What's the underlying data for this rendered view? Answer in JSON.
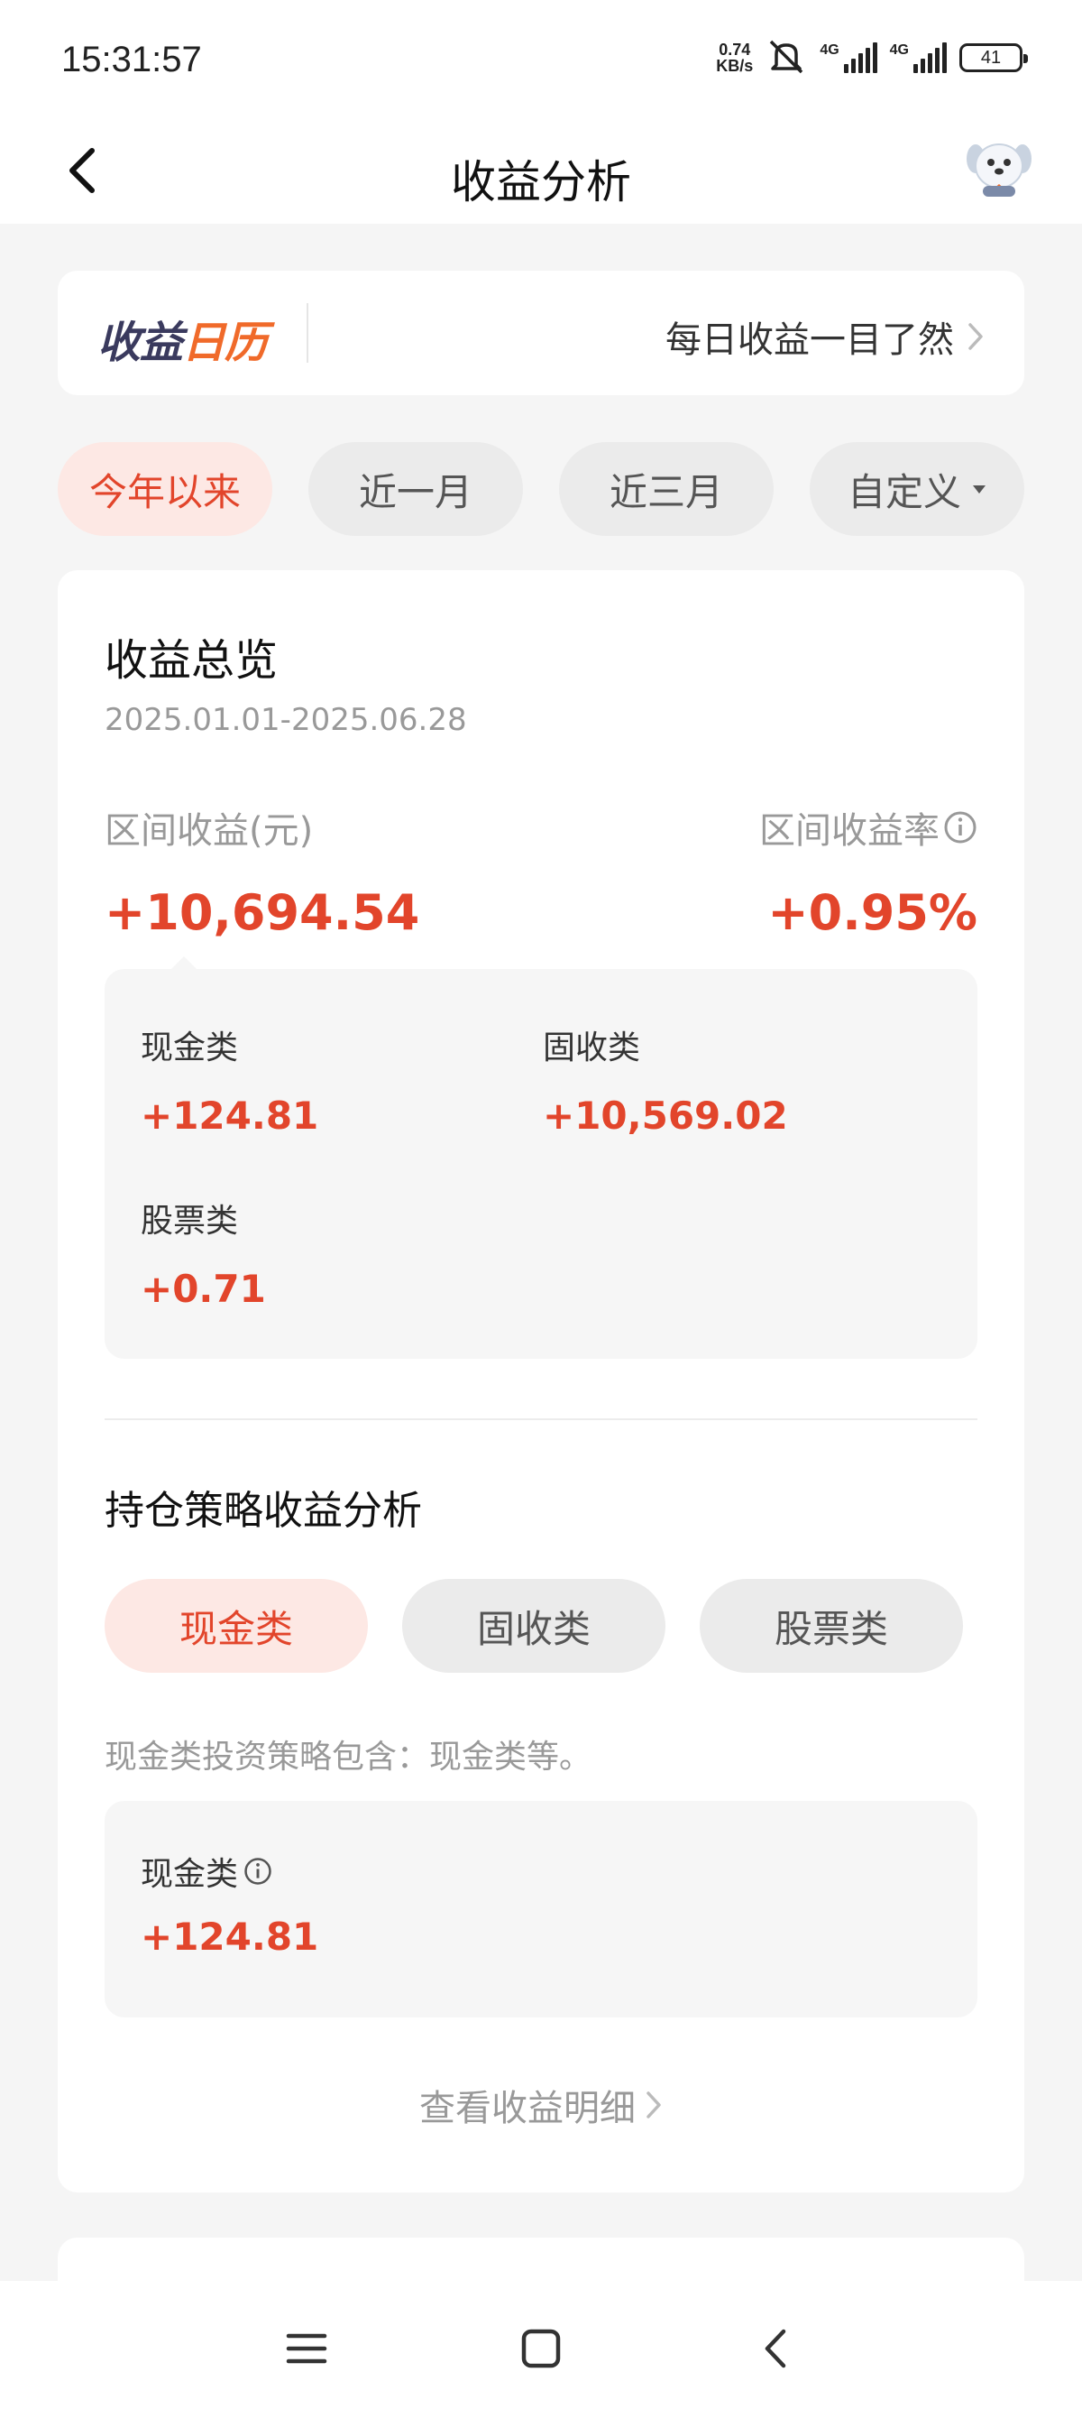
{
  "status": {
    "time": "15:31:57",
    "net_speed_value": "0.74",
    "net_speed_unit": "KB/s",
    "sim1_label": "4G",
    "sim2_label": "4G",
    "battery": "41"
  },
  "nav": {
    "title": "收益分析",
    "back_icon": "chevron-left-icon",
    "mascot_icon": "mascot-dog-icon"
  },
  "calendar": {
    "logo_part1": "收益",
    "logo_part2": "日历",
    "link_text": "每日收益一目了然"
  },
  "period_tabs": [
    {
      "label": "今年以来",
      "active": true
    },
    {
      "label": "近一月",
      "active": false
    },
    {
      "label": "近三月",
      "active": false
    },
    {
      "label": "自定义",
      "active": false,
      "has_dropdown": true
    }
  ],
  "overview": {
    "title": "收益总览",
    "date_range": "2025.01.01-2025.06.28",
    "interval_income_label": "区间收益(元)",
    "interval_rate_label": "区间收益率",
    "interval_income_value": "+10,694.54",
    "interval_rate_value": "+0.95%",
    "breakdown": [
      {
        "label": "现金类",
        "value": "+124.81"
      },
      {
        "label": "固收类",
        "value": "+10,569.02"
      },
      {
        "label": "股票类",
        "value": "+0.71"
      }
    ]
  },
  "strategy": {
    "title": "持仓策略收益分析",
    "tabs": [
      {
        "label": "现金类",
        "active": true
      },
      {
        "label": "固收类",
        "active": false
      },
      {
        "label": "股票类",
        "active": false
      }
    ],
    "description": "现金类投资策略包含：现金类等。",
    "box_label": "现金类",
    "box_value": "+124.81",
    "detail_link": "查看收益明细"
  },
  "colors": {
    "accent": "#e2452b",
    "accent_bg": "#fde8e4",
    "logo_dark": "#3a3a5e",
    "logo_orange": "#f06a2a"
  }
}
